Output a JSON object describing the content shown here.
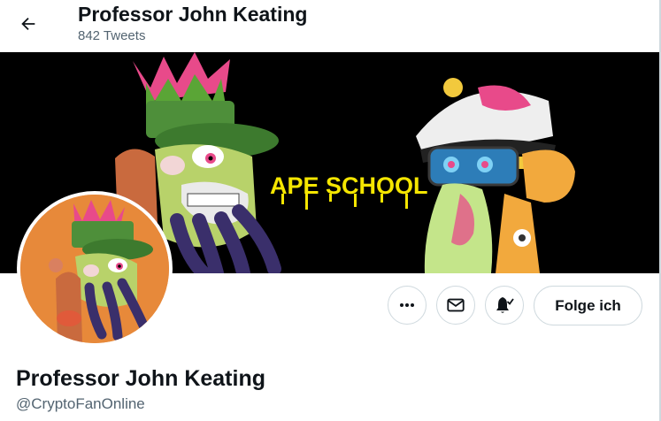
{
  "header": {
    "display_name": "Professor John Keating",
    "tweet_count": "842 Tweets",
    "back_icon": "arrow-left-icon"
  },
  "banner": {
    "caption": "APE SCHOOL",
    "background_color": "#000000",
    "caption_color": "#f5e600"
  },
  "avatar": {
    "background_color": "#e7893a"
  },
  "actions": {
    "more_icon": "more-dots-icon",
    "message_icon": "envelope-icon",
    "notify_icon": "bell-check-icon",
    "follow_label": "Folge ich"
  },
  "profile": {
    "display_name": "Professor John Keating",
    "handle": "@CryptoFanOnline"
  }
}
